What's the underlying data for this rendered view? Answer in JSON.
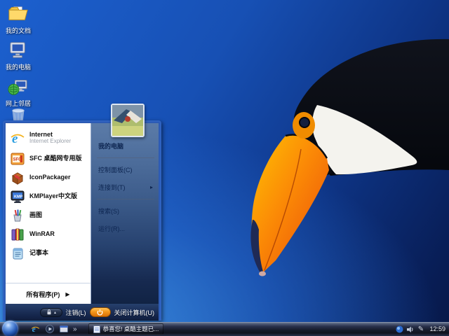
{
  "desktop": {
    "icons": [
      {
        "label": "我的文档",
        "icon": "my-documents"
      },
      {
        "label": "我的电脑",
        "icon": "my-computer"
      },
      {
        "label": "网上邻居",
        "icon": "network-places"
      },
      {
        "label": "",
        "icon": "recycle-bin"
      }
    ]
  },
  "start_menu": {
    "left_items": [
      {
        "label": "Internet",
        "sublabel": "Internet Explorer",
        "icon": "internet-explorer"
      },
      {
        "label": "SFC 桌酷网专用版",
        "icon": "sfc"
      },
      {
        "label": "IconPackager",
        "icon": "iconpackager"
      },
      {
        "label": "KMPlayer中文版",
        "icon": "kmplayer"
      },
      {
        "label": "画图",
        "icon": "paint"
      },
      {
        "label": "WinRAR",
        "icon": "winrar"
      },
      {
        "label": "记事本",
        "icon": "notepad"
      }
    ],
    "all_programs": "所有程序(P)",
    "all_programs_arrow": "▶",
    "right_items": [
      {
        "label": "我的电脑"
      },
      {
        "label": "控制面板(C)"
      },
      {
        "label": "连接到(T)",
        "arrow": "▸"
      },
      {
        "label": "搜索(S)"
      },
      {
        "label": "运行(R)..."
      }
    ],
    "logoff_label": "注销(L)",
    "logoff_arrow": "▴",
    "shutdown_label": "关闭计算机(U)"
  },
  "taskbar": {
    "overflow_chevron": "»",
    "task_button": "恭喜您! 桌酷主题已...",
    "clock": "12:59"
  },
  "colors": {
    "wallpaper_top_right": "#071847",
    "wallpaper_bottom_left": "#2f86dd",
    "menu_border": "#2f62c0",
    "menu_right_top": "#5b7ba8",
    "menu_right_bottom": "#112344",
    "power_button": "#f59a1e",
    "beak_orange": "#f97b06",
    "taskbar_dark": "#10141f"
  }
}
